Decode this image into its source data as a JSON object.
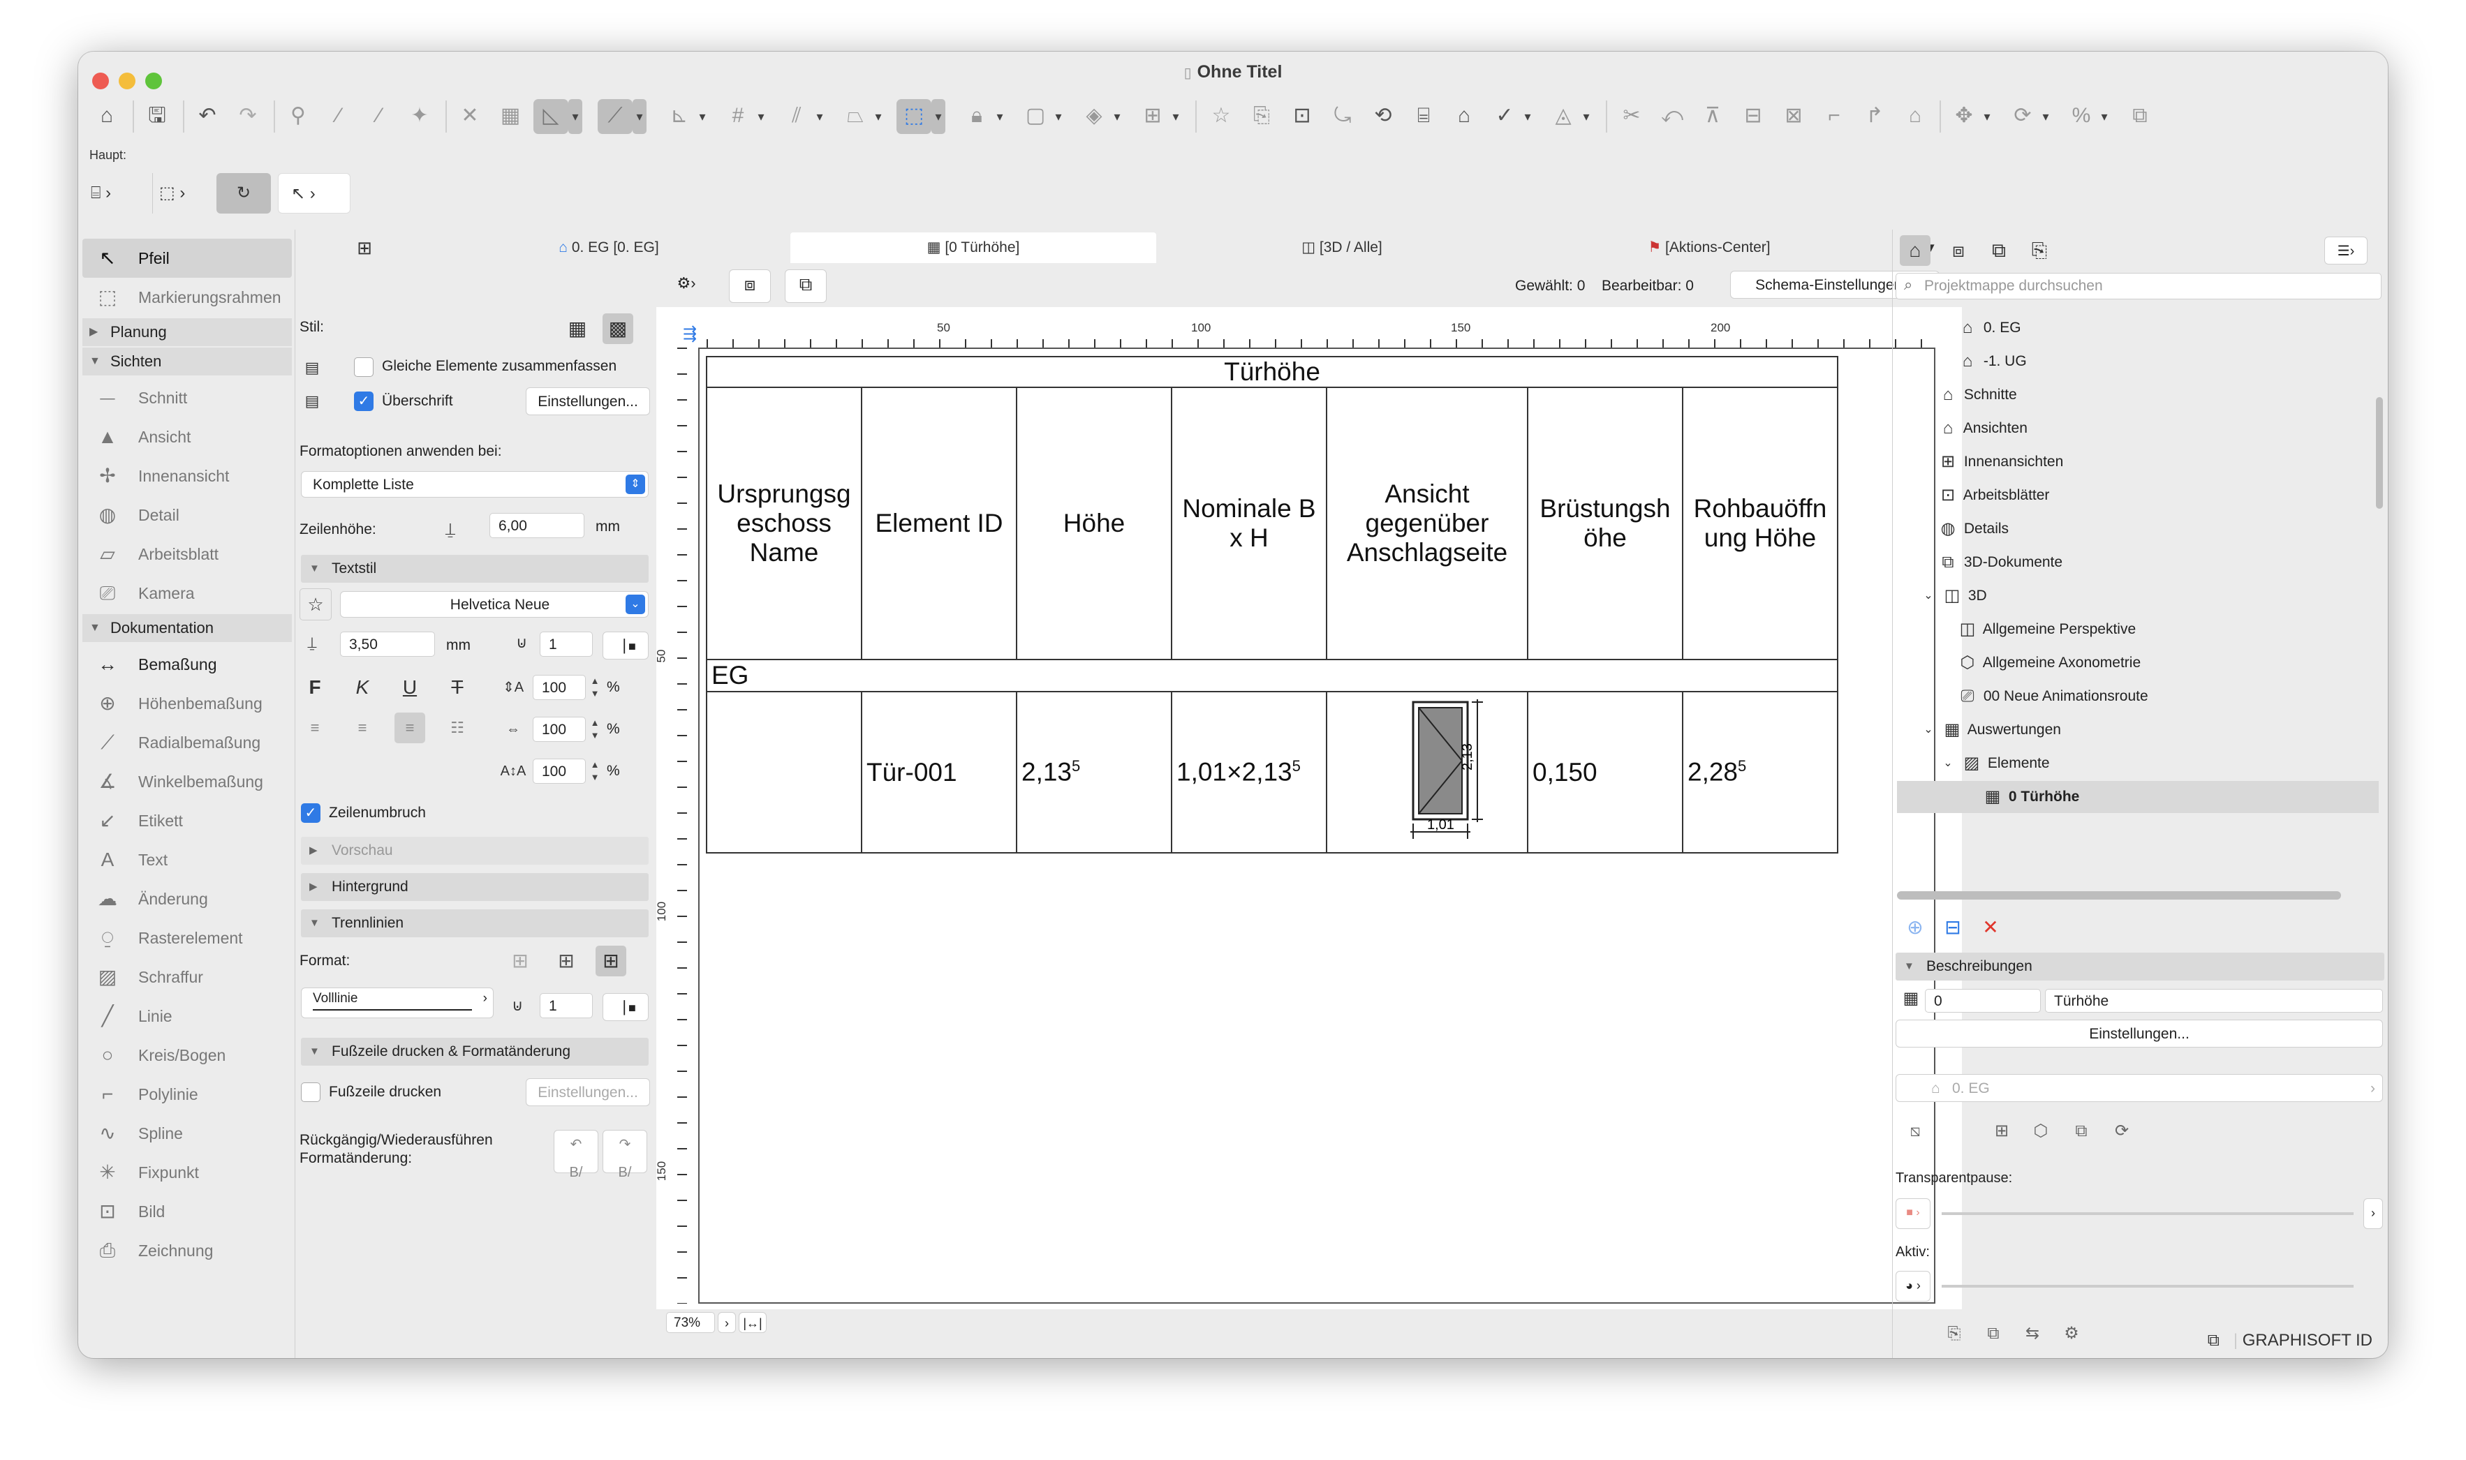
{
  "window": {
    "title": "Ohne Titel"
  },
  "toolbar_label": "Haupt:",
  "toolbox": {
    "top": [
      {
        "label": "Pfeil",
        "icon": "arrow-icon"
      },
      {
        "label": "Markierungsrahmen",
        "icon": "marquee-icon"
      }
    ],
    "categories": {
      "planung": "Planung",
      "sichten": "Sichten",
      "dokumentation": "Dokumentation"
    },
    "sichten": [
      {
        "label": "Schnitt"
      },
      {
        "label": "Ansicht"
      },
      {
        "label": "Innenansicht"
      },
      {
        "label": "Detail"
      },
      {
        "label": "Arbeitsblatt"
      },
      {
        "label": "Kamera"
      }
    ],
    "dokumentation": [
      {
        "label": "Bemaßung"
      },
      {
        "label": "Höhenbemaßung"
      },
      {
        "label": "Radialbemaßung"
      },
      {
        "label": "Winkelbemaßung"
      },
      {
        "label": "Etikett"
      },
      {
        "label": "Text"
      },
      {
        "label": "Änderung"
      },
      {
        "label": "Rasterelement"
      },
      {
        "label": "Schraffur"
      },
      {
        "label": "Linie"
      },
      {
        "label": "Kreis/Bogen"
      },
      {
        "label": "Polylinie"
      },
      {
        "label": "Spline"
      },
      {
        "label": "Fixpunkt"
      },
      {
        "label": "Bild"
      },
      {
        "label": "Zeichnung"
      }
    ]
  },
  "settings": {
    "stil": "Stil:",
    "merge_label": "Gleiche Elemente zusammenfassen",
    "merge_checked": false,
    "heading_label": "Überschrift",
    "heading_checked": true,
    "einstellungen": "Einstellungen...",
    "format_apply": "Formatoptionen anwenden bei:",
    "format_apply_value": "Komplette Liste",
    "row_height_label": "Zeilenhöhe:",
    "row_height": "6,00",
    "unit_mm": "mm",
    "textstil": "Textstil",
    "font": "Helvetica Neue",
    "text_size": "3,50",
    "pen": "1",
    "bold": "F",
    "italic": "K",
    "underline": "U",
    "strike": "T",
    "scale_a": "100",
    "scale_b": "100",
    "scale_c": "100",
    "percent": "%",
    "wrap_label": "Zeilenumbruch",
    "wrap_checked": true,
    "vorschau": "Vorschau",
    "hintergrund": "Hintergrund",
    "trennlinien": "Trennlinien",
    "format_label": "Format:",
    "line_type": "Volllinie",
    "line_pen": "1",
    "footer_section": "Fußzeile drucken & Formatänderung",
    "footer_print": "Fußzeile drucken",
    "footer_checked": false,
    "undo_label": "Rückgängig/Wiederausführen Formatänderung:"
  },
  "tabs": [
    {
      "label": "0. EG [0. EG]",
      "icon": "floorplan-icon"
    },
    {
      "label": "[0 Türhöhe]",
      "icon": "schedule-icon"
    },
    {
      "label": "[3D / Alle]",
      "icon": "3d-icon"
    },
    {
      "label": "[Aktions-Center]",
      "icon": "action-center-icon"
    }
  ],
  "view": {
    "selected": "Gewählt: 0",
    "editable": "Bearbeitbar: 0",
    "schema_button": "Schema-Einstellungen...",
    "zoom": "73%"
  },
  "ruler_h": [
    "50",
    "100",
    "150",
    "200"
  ],
  "ruler_v": [
    "50",
    "100",
    "150"
  ],
  "schedule": {
    "title": "Türhöhe",
    "headers": [
      "Ursprungsg eschoss Name",
      "Element ID",
      "Höhe",
      "Nominale B x H",
      "Ansicht gegenüber Anschlagseite",
      "Brüstungsh öhe",
      "Rohbauöffn ung Höhe"
    ],
    "group": "EG",
    "row": {
      "name": "",
      "id": "Tür-001",
      "hoehe": "2,13",
      "hoehe_sup": "5",
      "nominal": "1,01×2,13",
      "nominal_sup": "5",
      "view_width": "1,01",
      "view_height": "2,13",
      "view_height_sup": "5",
      "bruestung": "0,150",
      "rohbau": "2,28",
      "rohbau_sup": "5"
    }
  },
  "navigator": {
    "search_placeholder": "Projektmappe durchsuchen",
    "items": [
      {
        "label": "0. EG",
        "level": 3,
        "icon": "story-icon"
      },
      {
        "label": "-1. UG",
        "level": 3,
        "icon": "story-icon"
      },
      {
        "label": "Schnitte",
        "level": 2,
        "icon": "section-icon"
      },
      {
        "label": "Ansichten",
        "level": 2,
        "icon": "elevation-icon"
      },
      {
        "label": "Innenansichten",
        "level": 2,
        "icon": "interior-icon"
      },
      {
        "label": "Arbeitsblätter",
        "level": 2,
        "icon": "worksheet-icon"
      },
      {
        "label": "Details",
        "level": 2,
        "icon": "detail-icon"
      },
      {
        "label": "3D-Dokumente",
        "level": 2,
        "icon": "3d-doc-icon"
      },
      {
        "label": "3D",
        "level": 2,
        "icon": "3d-icon",
        "expanded": true
      },
      {
        "label": "Allgemeine Perspektive",
        "level": 3,
        "icon": "perspective-icon"
      },
      {
        "label": "Allgemeine Axonometrie",
        "level": 3,
        "icon": "axonometry-icon"
      },
      {
        "label": "00 Neue Animationsroute",
        "level": 3,
        "icon": "camera-icon"
      },
      {
        "label": "Auswertungen",
        "level": 2,
        "icon": "schedule-icon",
        "expanded": true
      },
      {
        "label": "Elemente",
        "level": 3,
        "icon": "elements-icon",
        "expanded": true
      },
      {
        "label": "0 Türhöhe",
        "level": 4,
        "icon": "schedule-icon",
        "selected": true
      }
    ],
    "beschreibungen": "Beschreibungen",
    "desc_id": "0",
    "desc_name": "Türhöhe",
    "settings_button": "Einstellungen...",
    "story_ref": "0. EG",
    "transparent": "Transparentpause:",
    "aktiv": "Aktiv:"
  },
  "footer_brand": "GRAPHISOFT ID",
  "colors": {
    "accent": "#2f7ae5",
    "close": "#ee5b52",
    "min": "#f4bd3b",
    "max": "#5fc43b",
    "delete": "#e0362c"
  }
}
